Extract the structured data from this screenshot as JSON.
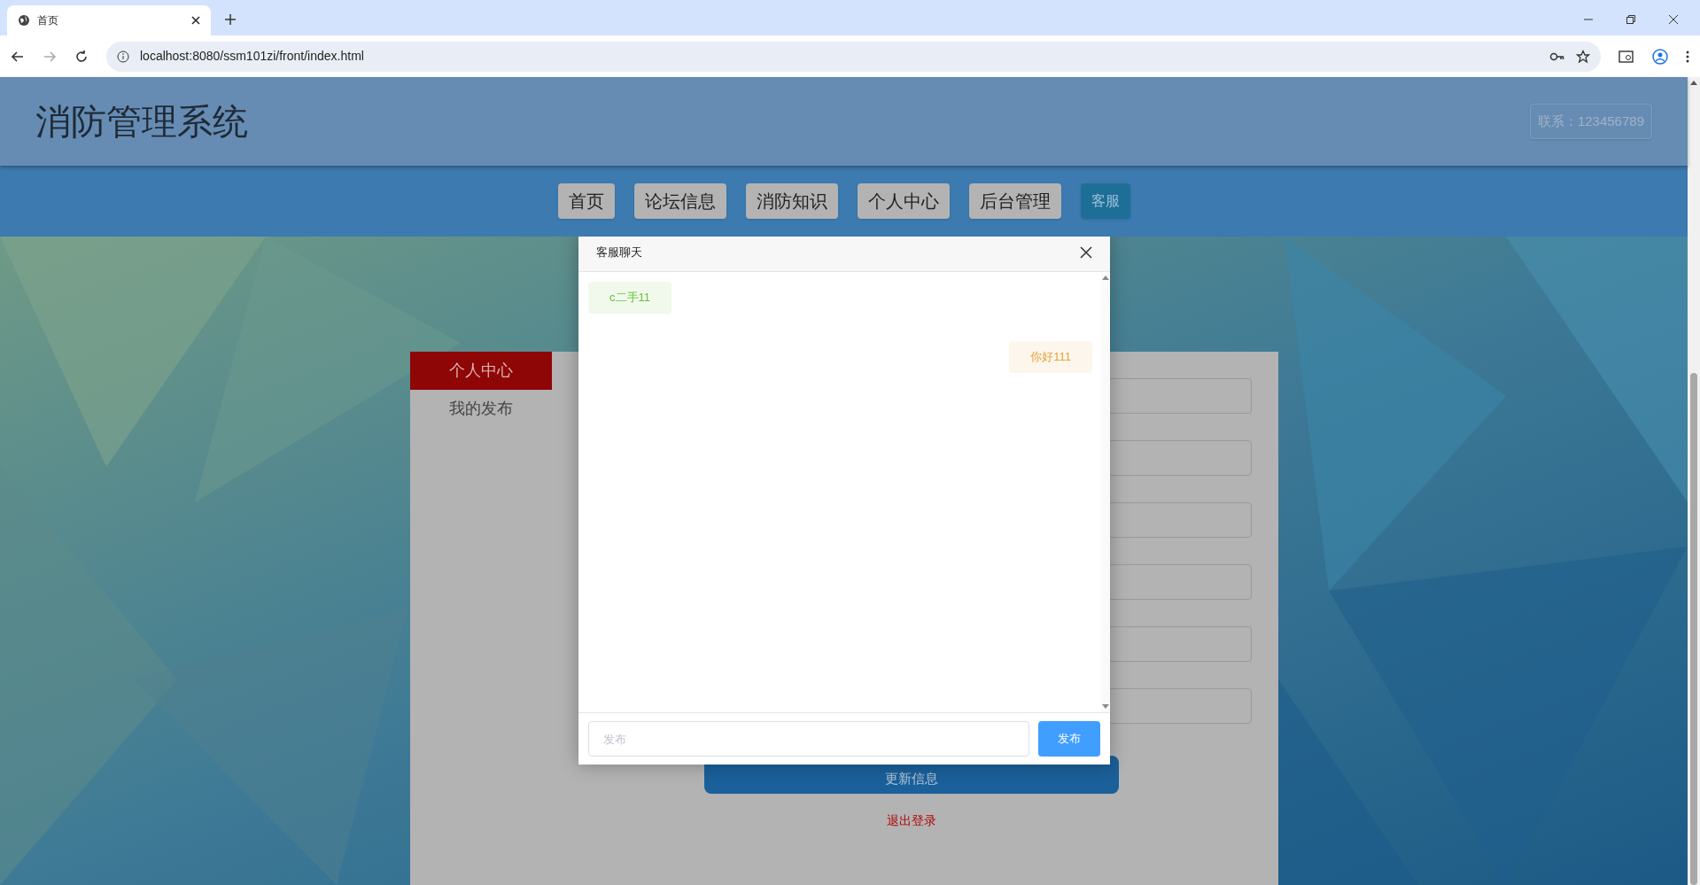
{
  "browser": {
    "tab_title": "首页",
    "url": "localhost:8080/ssm101zi/front/index.html"
  },
  "header": {
    "title": "消防管理系统",
    "contact": "联系：123456789"
  },
  "nav": [
    {
      "label": "首页",
      "selected": false
    },
    {
      "label": "论坛信息",
      "selected": false
    },
    {
      "label": "消防知识",
      "selected": false
    },
    {
      "label": "个人中心",
      "selected": false
    },
    {
      "label": "后台管理",
      "selected": false
    },
    {
      "label": "客服",
      "selected": true
    }
  ],
  "sidebar": [
    {
      "label": "个人中心",
      "selected": true
    },
    {
      "label": "我的发布",
      "selected": false
    }
  ],
  "form": {
    "field_count_hint": [
      {
        "kind": "field"
      },
      {
        "kind": "field"
      },
      {
        "kind": "field"
      },
      {
        "kind": "field"
      },
      {
        "kind": "field"
      },
      {
        "kind": "field"
      }
    ],
    "update_button": "更新信息",
    "logout_link": "退出登录"
  },
  "chat_dialog": {
    "title": "客服聊天",
    "messages": [
      {
        "text": "c二手11",
        "kind": "received"
      },
      {
        "text": "你好111",
        "kind": "sent"
      }
    ],
    "input": {
      "placeholder": "发布"
    },
    "send_button": "发布"
  }
}
